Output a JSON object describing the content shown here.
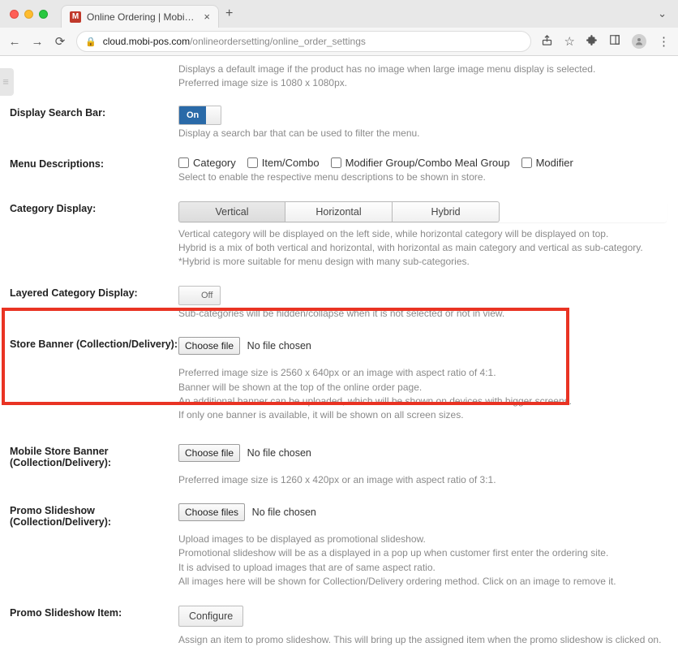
{
  "browser": {
    "tab_title": "Online Ordering | MobiPOS",
    "favicon_letter": "M",
    "url_host": "cloud.mobi-pos.com",
    "url_path": "/onlineordersetting/online_order_settings"
  },
  "top_help": {
    "line1": "Displays a default image if the product has no image when large image menu display is selected.",
    "line2": "Preferred image size is 1080 x 1080px."
  },
  "searchBar": {
    "label": "Display Search Bar:",
    "state": "On",
    "help": "Display a search bar that can be used to filter the menu."
  },
  "menuDesc": {
    "label": "Menu Descriptions:",
    "options": [
      "Category",
      "Item/Combo",
      "Modifier Group/Combo Meal Group",
      "Modifier"
    ],
    "help": "Select to enable the respective menu descriptions to be shown in store."
  },
  "catDisplay": {
    "label": "Category Display:",
    "options": [
      "Vertical",
      "Horizontal",
      "Hybrid"
    ],
    "help1": "Vertical category will be displayed on the left side, while horizontal category will be displayed on top.",
    "help2": "Hybrid is a mix of both vertical and horizontal, with horizontal as main category and vertical as sub-category.",
    "help3": "*Hybrid is more suitable for menu design with many sub-categories."
  },
  "layered": {
    "label": "Layered Category Display:",
    "state": "Off",
    "help": "Sub-categories will be hidden/collapse when it is not selected or not in view."
  },
  "storeBanner": {
    "label": "Store Banner (Collection/Delivery):",
    "btn": "Choose file",
    "status": "No file chosen",
    "help1": "Preferred image size is 2560 x 640px or an image with aspect ratio of 4:1.",
    "help2": "Banner will be shown at the top of the online order page.",
    "help3": "An additional banner can be uploaded, which will be shown on devices with bigger screens.",
    "help4": "If only one banner is available, it will be shown on all screen sizes."
  },
  "mobileBanner": {
    "label": "Mobile Store Banner (Collection/Delivery):",
    "btn": "Choose file",
    "status": "No file chosen",
    "help": "Preferred image size is 1260 x 420px or an image with aspect ratio of 3:1."
  },
  "promo": {
    "label": "Promo Slideshow (Collection/Delivery):",
    "btn": "Choose files",
    "status": "No file chosen",
    "help1": "Upload images to be displayed as promotional slideshow.",
    "help2": "Promotional slideshow will be as a displayed in a pop up when customer first enter the ordering site.",
    "help3": "It is advised to upload images that are of same aspect ratio.",
    "help4": "All images here will be shown for Collection/Delivery ordering method. Click on an image to remove it."
  },
  "promoItem": {
    "label": "Promo Slideshow Item:",
    "btn": "Configure",
    "help": "Assign an item to promo slideshow. This will bring up the assigned item when the promo slideshow is clicked on."
  }
}
